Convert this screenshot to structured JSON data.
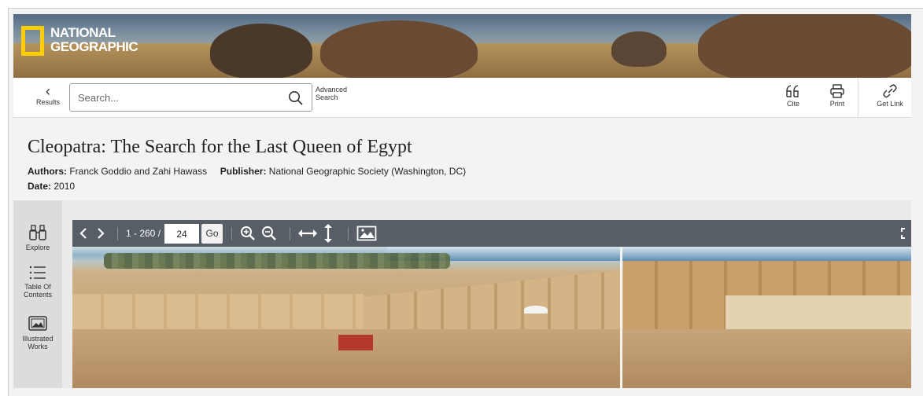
{
  "banner": {
    "logo_line1": "NATIONAL",
    "logo_line2": "GEOGRAPHIC",
    "logo_color": "#ffce00"
  },
  "toolbar": {
    "back_label": "Results",
    "search_placeholder": "Search...",
    "advanced_line1": "Advanced",
    "advanced_line2": "Search",
    "cite_label": "Cite",
    "print_label": "Print",
    "getlink_label": "Get Link"
  },
  "document": {
    "title": "Cleopatra: The Search for the Last Queen of Egypt",
    "authors_label": "Authors:",
    "authors": "Franck Goddio and Zahi Hawass",
    "publisher_label": "Publisher:",
    "publisher": "National Geographic Society (Washington, DC)",
    "date_label": "Date:",
    "date": "2010"
  },
  "sidebar": {
    "items": [
      {
        "label": "Explore",
        "icon": "binoculars-icon"
      },
      {
        "label_line1": "Table Of",
        "label_line2": "Contents",
        "icon": "list-icon"
      },
      {
        "label_line1": "Illustrated",
        "label_line2": "Works",
        "icon": "image-icon"
      }
    ]
  },
  "viewer": {
    "page_range": "1 - 260 /",
    "current_page": "24",
    "go_label": "Go",
    "toolbar_bg": "#575e66"
  }
}
